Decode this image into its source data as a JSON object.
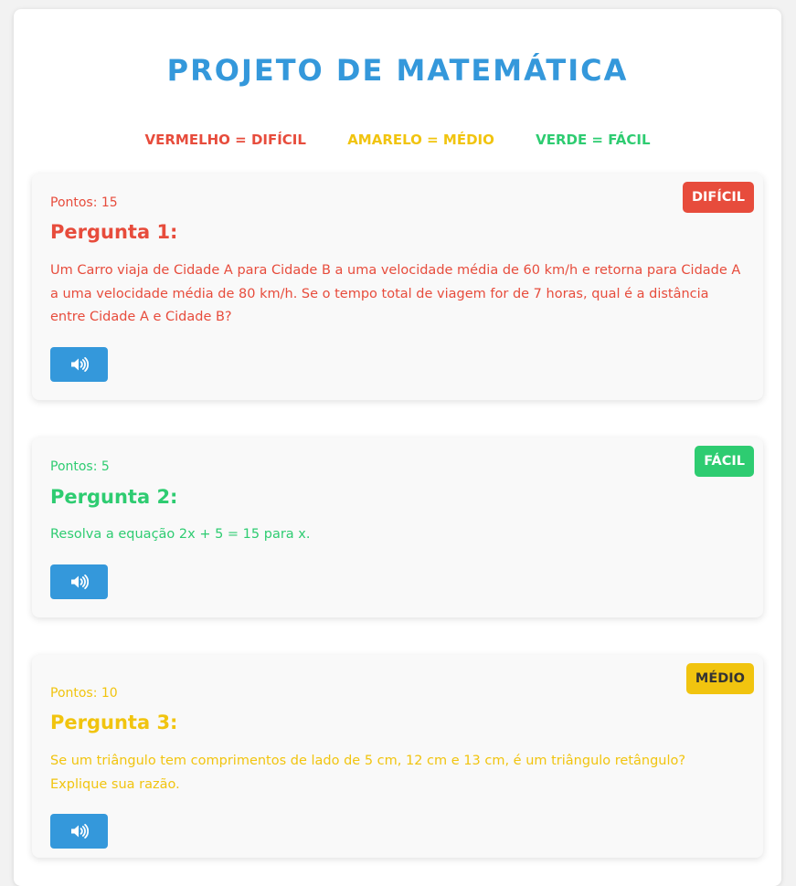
{
  "page": {
    "title": "PROJETO DE MATEMÁTICA"
  },
  "legend": {
    "hard": "VERMELHO = DIFÍCIL",
    "medium": "AMARELO = MÉDIO",
    "easy": "VERDE = FÁCIL"
  },
  "colors": {
    "hard": "#e74c3c",
    "medium": "#f1c40f",
    "easy": "#2ecc71",
    "accent": "#3498db"
  },
  "questions": [
    {
      "badge": "DIFÍCIL",
      "points": "Pontos: 15",
      "title": "Pergunta 1:",
      "text": "Um Carro viaja de Cidade A para Cidade B a uma velocidade média de 60 km/h e retorna para Cidade A a uma velocidade média de 80 km/h. Se o tempo total de viagem for de 7 horas, qual é a distância entre Cidade A e Cidade B?",
      "audio_icon": "speaker-icon"
    },
    {
      "badge": "FÁCIL",
      "points": "Pontos: 5",
      "title": "Pergunta 2:",
      "text": "Resolva a equação 2x + 5 = 15 para x.",
      "audio_icon": "speaker-icon"
    },
    {
      "badge": "MÉDIO",
      "points": "Pontos: 10",
      "title": "Pergunta 3:",
      "text": "Se um triângulo tem comprimentos de lado de 5 cm, 12 cm e 13 cm, é um triângulo retângulo? Explique sua razão.",
      "audio_icon": "speaker-icon"
    }
  ]
}
